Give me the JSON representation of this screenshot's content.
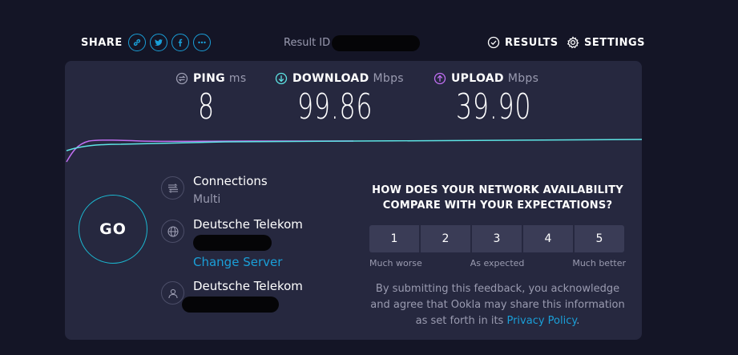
{
  "header": {
    "share_label": "SHARE",
    "share_buttons": [
      {
        "icon": "link-icon"
      },
      {
        "icon": "twitter-icon"
      },
      {
        "icon": "facebook-icon"
      },
      {
        "icon": "more-icon"
      }
    ],
    "result_id_label": "Result ID",
    "results_label": "RESULTS",
    "settings_label": "SETTINGS"
  },
  "metrics": {
    "ping": {
      "label": "PING",
      "unit": "ms",
      "value": "8"
    },
    "download": {
      "label": "DOWNLOAD",
      "unit": "Mbps",
      "value": "99.86"
    },
    "upload": {
      "label": "UPLOAD",
      "unit": "Mbps",
      "value": "39.90"
    }
  },
  "colors": {
    "accent": "#1a9fd8",
    "download": "#5de4e4",
    "upload": "#c06ff2",
    "card": "#26283f",
    "background": "#141526"
  },
  "go_label": "GO",
  "connections": {
    "title": "Connections",
    "value": "Multi"
  },
  "server": {
    "provider": "Deutsche Telekom",
    "change_label": "Change Server"
  },
  "client": {
    "provider": "Deutsche Telekom"
  },
  "feedback": {
    "question_line1": "HOW DOES YOUR NETWORK AVAILABILITY",
    "question_line2": "COMPARE WITH YOUR EXPECTATIONS?",
    "scale": [
      "1",
      "2",
      "3",
      "4",
      "5"
    ],
    "low_label": "Much worse",
    "mid_label": "As expected",
    "high_label": "Much better",
    "disclaimer_1": "By submitting this feedback, you acknowledge",
    "disclaimer_2": "and agree that Ookla may share this information",
    "disclaimer_3": "as set forth in its ",
    "privacy_label": "Privacy Policy",
    "disclaimer_end": "."
  }
}
